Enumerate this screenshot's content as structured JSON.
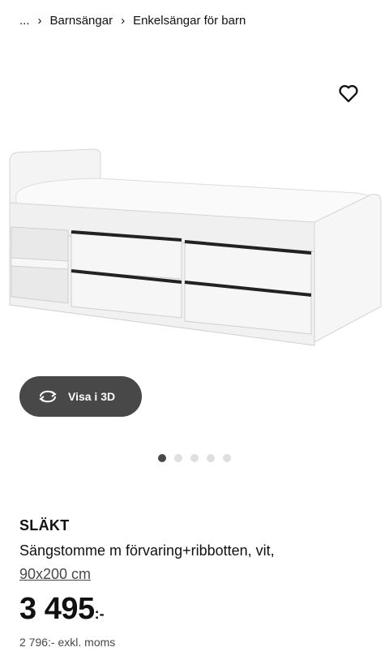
{
  "breadcrumb": {
    "ellipsis": "...",
    "items": [
      "Barnsängar",
      "Enkelsängar för barn"
    ]
  },
  "icons": {
    "wishlist": "heart-icon",
    "rotate": "rotate-3d-icon",
    "separator": "chevron-right-icon"
  },
  "viewer": {
    "button_label": "Visa i 3D",
    "images_total": 5,
    "active_image": 1
  },
  "product": {
    "brand": "SLÄKT",
    "description": "Sängstomme m förvaring+ribbotten, vit,",
    "size": "90x200 cm",
    "price": "3 495",
    "currency": ":-",
    "price_excl_vat": "2 796:- exkl. moms"
  },
  "colors": {
    "button_bg": "#484848",
    "dot_active": "#484848",
    "dot_inactive": "#dfdfdf"
  }
}
